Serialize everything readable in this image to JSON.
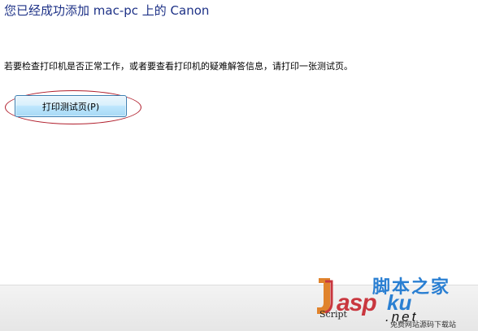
{
  "dialog": {
    "heading": "您已经成功添加 mac-pc 上的 Canon",
    "info_text": "若要检查打印机是否正常工作，或者要查看打印机的疑难解答信息，请打印一张测试页。",
    "print_test_page_button": "打印测试页(P)"
  },
  "watermark": {
    "site_name_cn": "脚本之家",
    "script_label": "Script",
    "asp_label": "asp",
    "ku_label": "ku",
    "net_label": ".net",
    "tagline": "免费网站源码下载站"
  },
  "colors": {
    "heading_text": "#1e3287",
    "highlight_ellipse": "#b01e2c",
    "button_border": "#3c7fb1"
  }
}
